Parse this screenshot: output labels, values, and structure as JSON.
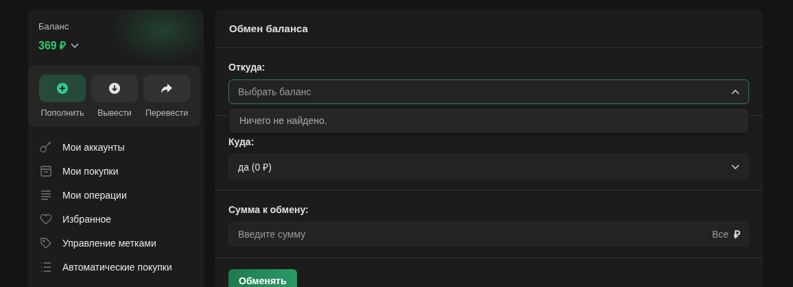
{
  "sidebar": {
    "balance_label": "Баланс",
    "balance": "369 ₽",
    "actions": [
      {
        "kind": "add",
        "label": "Пополнить"
      },
      {
        "kind": "withdraw",
        "label": "Вывести"
      },
      {
        "kind": "transfer",
        "label": "Перевести"
      }
    ],
    "items": [
      {
        "kind": "key",
        "label": "Мои аккаунты"
      },
      {
        "kind": "bag",
        "label": "Мои покупки"
      },
      {
        "kind": "lines",
        "label": "Мои операции"
      },
      {
        "kind": "heart",
        "label": "Избранное"
      },
      {
        "kind": "tag",
        "label": "Управление метками"
      },
      {
        "kind": "list",
        "label": "Автоматические покупки"
      }
    ]
  },
  "exchange": {
    "title": "Обмен баланса",
    "from": {
      "label": "Откуда:",
      "placeholder": "Выбрать баланс",
      "expanded": true,
      "dropdown_message": "Ничего не найдено."
    },
    "to": {
      "label": "Куда:",
      "value": "да (0 ₽)",
      "expanded": false
    },
    "amount": {
      "label": "Сумма к обмену:",
      "placeholder": "Введите сумму",
      "all": "Все",
      "currency": "₽"
    },
    "submit": "Обменять"
  }
}
